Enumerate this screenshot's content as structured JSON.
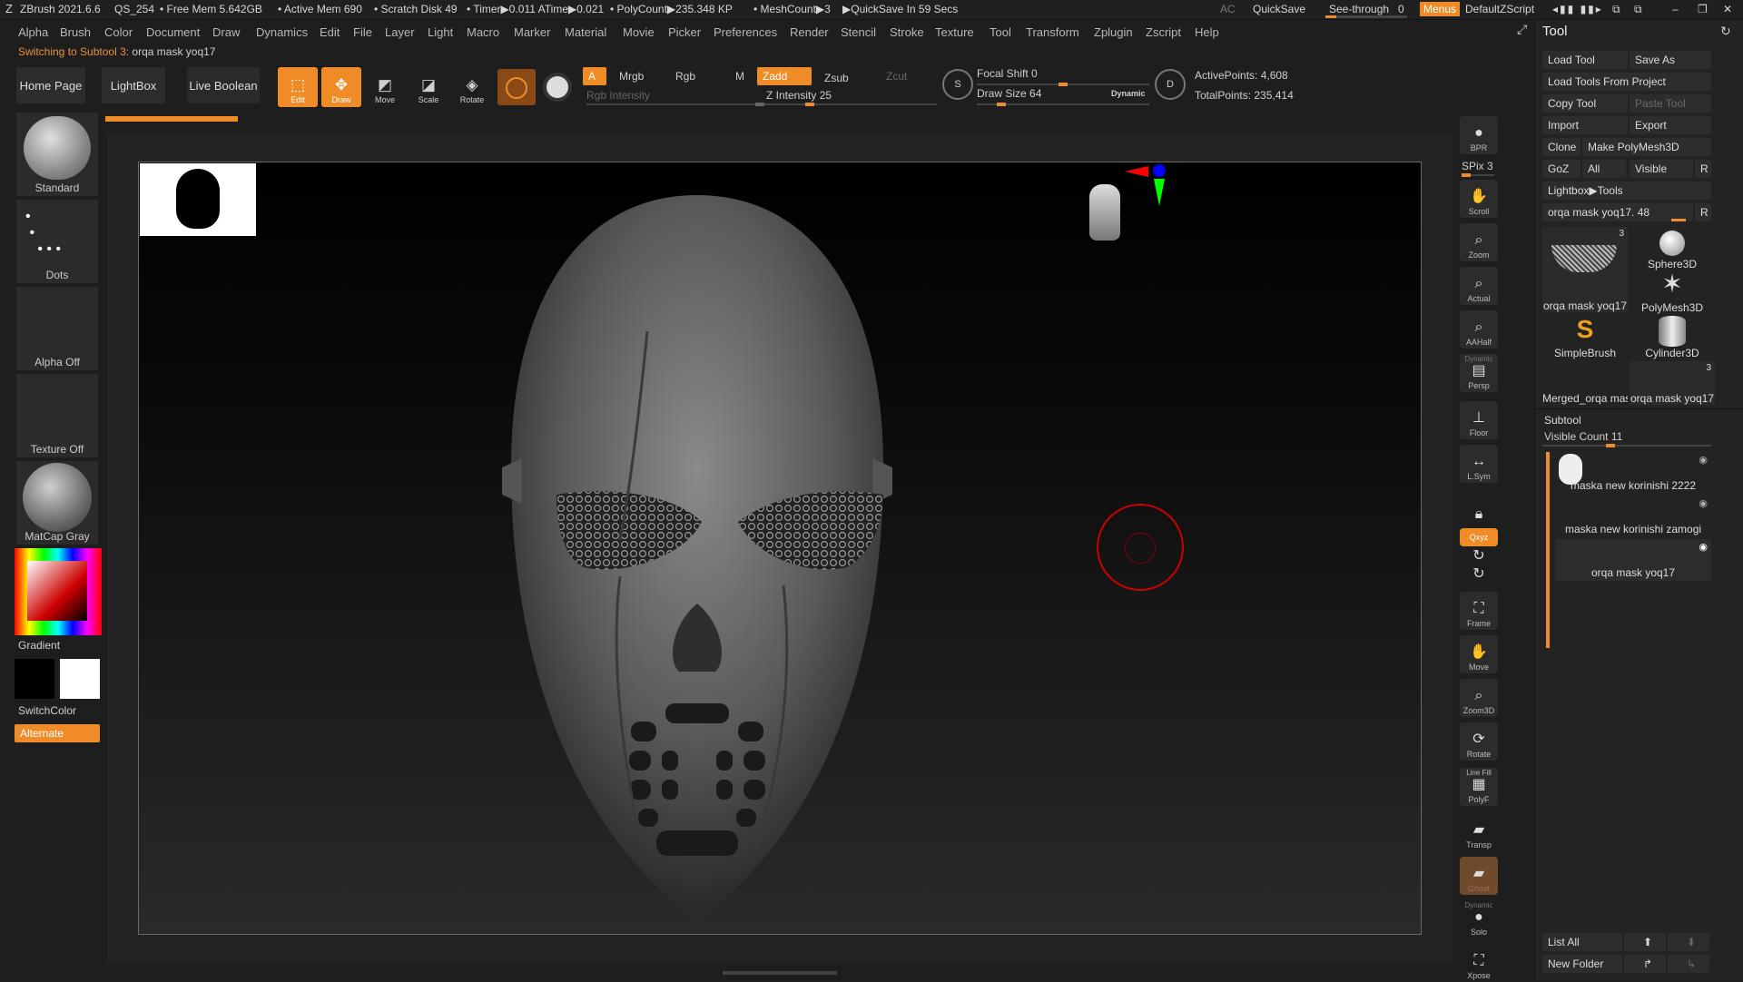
{
  "title": {
    "app": "ZBrush 2021.6.6",
    "doc": "QS_254",
    "freemem": "• Free Mem 5.642GB",
    "activemem": "• Active Mem 690",
    "scratch": "• Scratch Disk 49",
    "timer": "• Timer▶0.011 ATime▶0.021",
    "polycount": "• PolyCount▶235.348 KP",
    "meshcount": "• MeshCount▶3",
    "quicksave_in": "▶QuickSave In 59 Secs",
    "ac": "AC",
    "quicksave": "QuickSave",
    "seethrough": "See-through",
    "seethrough_val": "0",
    "menus": "Menus",
    "script": "DefaultZScript"
  },
  "menu": [
    "Alpha",
    "Brush",
    "Color",
    "Document",
    "Draw",
    "Dynamics",
    "Edit",
    "File",
    "Layer",
    "Light",
    "Macro",
    "Marker",
    "Material",
    "Movie",
    "Picker",
    "Preferences",
    "Render",
    "Stencil",
    "Stroke",
    "Texture",
    "Tool",
    "Transform",
    "Zplugin",
    "Zscript",
    "Help"
  ],
  "notice": {
    "prefix": "Switching to Subtool 3:",
    "name": "orqa mask yoq17"
  },
  "shelf": {
    "home": "Home Page",
    "lightbox": "LightBox",
    "liveboolean": "Live Boolean",
    "edit": "Edit",
    "draw": "Draw",
    "move": "Move",
    "scale": "Scale",
    "rotate": "Rotate",
    "a": "A",
    "mrgb": "Mrgb",
    "rgb": "Rgb",
    "m": "M",
    "rgb_intensity": "Rgb Intensity",
    "zadd": "Zadd",
    "zsub": "Zsub",
    "zcut": "Zcut",
    "z_intensity": "Z Intensity 25",
    "z_intensity_val": 0.25,
    "focal": "Focal Shift 0",
    "focal_val": 0.5,
    "drawsize": "Draw Size 64",
    "drawsize_val": 0.12,
    "dynamic": "Dynamic",
    "active": "ActivePoints: 4,608",
    "total": "TotalPoints: 235,414"
  },
  "left": {
    "brush": "Standard",
    "stroke": "Dots",
    "alpha": "Alpha Off",
    "texture": "Texture Off",
    "material": "MatCap Gray",
    "gradient": "Gradient",
    "switchcolor": "SwitchColor",
    "alternate": "Alternate"
  },
  "right": {
    "bpr": "BPR",
    "spix": "SPix 3",
    "scroll": "Scroll",
    "zoom": "Zoom",
    "actual": "Actual",
    "aahalf": "AAHalf",
    "dynamic": "Dynamic",
    "persp": "Persp",
    "floor": "Floor",
    "lsym": "L.Sym",
    "xyz": "Qxyz",
    "frame": "Frame",
    "move": "Move",
    "zoom3d": "Zoom3D",
    "rotate": "Rotate",
    "linefill": "Line Fill",
    "polyf": "PolyF",
    "transp": "Transp",
    "ghost": "Ghost",
    "solo_dyn": "Dynamic",
    "solo": "Solo",
    "xpose": "Xpose"
  },
  "tool": {
    "header": "Tool",
    "load": "Load Tool",
    "saveas": "Save As",
    "loadproj": "Load Tools From Project",
    "copy": "Copy Tool",
    "paste": "Paste Tool",
    "import": "Import",
    "export": "Export",
    "clone": "Clone",
    "makepoly": "Make PolyMesh3D",
    "goz": "GoZ",
    "all": "All",
    "visible": "Visible",
    "r": "R",
    "lightbox": "Lightbox▶Tools",
    "current": "orqa mask yoq17. 48",
    "thumbs": [
      "orqa mask yoq17",
      "Sphere3D",
      "PolyMesh3D",
      "SimpleBrush",
      "Cylinder3D",
      "Merged_orqa mask",
      "orqa mask yoq17"
    ],
    "thumb_counts": [
      "3",
      "3"
    ],
    "subtool": "Subtool",
    "visiblecount": "Visible Count 11",
    "subtools": [
      "maska new korinishi 2222",
      "maska new korinishi zamogi",
      "orqa mask yoq17"
    ],
    "listall": "List All",
    "newfolder": "New Folder"
  },
  "accent": "#f08c28"
}
